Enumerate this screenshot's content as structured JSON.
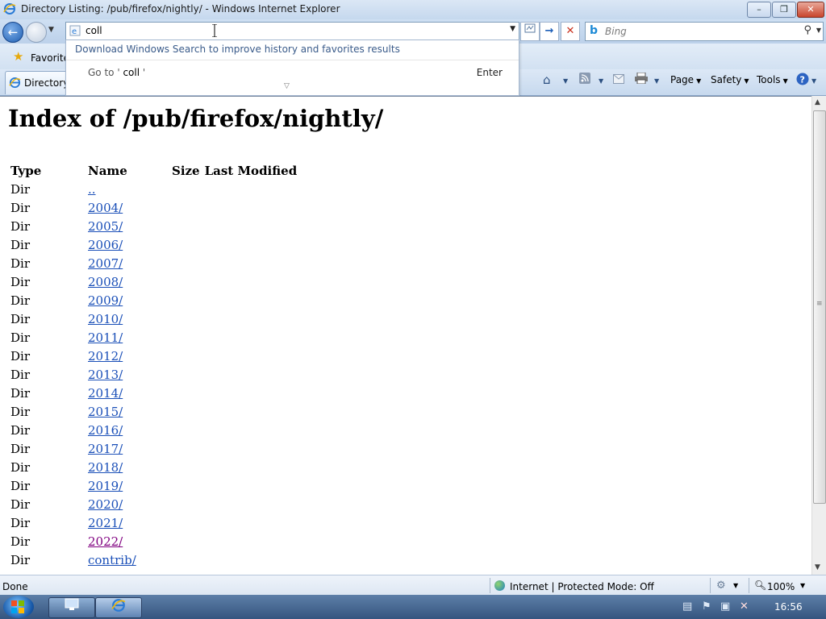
{
  "window": {
    "title": "Directory Listing: /pub/firefox/nightly/ - Windows Internet Explorer",
    "minimize": "–",
    "maximize": "❐",
    "close": "✕"
  },
  "nav": {
    "back_icon": "back-arrow-icon",
    "forward_icon": "forward-arrow-icon",
    "address_value": "coll",
    "search_placeholder": "Bing",
    "search_logo": "b",
    "compat_icon": "compatibility-view-icon",
    "go_icon": "→",
    "stop_icon": "✕"
  },
  "dropdown": {
    "download_text": "Download Windows Search to improve history and favorites results",
    "goto_prefix": "Go to '",
    "goto_value": "coll",
    "goto_suffix": "'",
    "enter": "Enter"
  },
  "favorites": {
    "label": "Favorite"
  },
  "tab": {
    "label": "Directory"
  },
  "commandbar": {
    "page": "Page",
    "safety": "Safety",
    "tools": "Tools"
  },
  "content": {
    "heading": "Index of /pub/firefox/nightly/",
    "columns": [
      "Type",
      "Name",
      "Size",
      "Last Modified"
    ],
    "rows": [
      {
        "type": "Dir",
        "name": "..",
        "visited": false
      },
      {
        "type": "Dir",
        "name": "2004/",
        "visited": false
      },
      {
        "type": "Dir",
        "name": "2005/",
        "visited": false
      },
      {
        "type": "Dir",
        "name": "2006/",
        "visited": false
      },
      {
        "type": "Dir",
        "name": "2007/",
        "visited": false
      },
      {
        "type": "Dir",
        "name": "2008/",
        "visited": false
      },
      {
        "type": "Dir",
        "name": "2009/",
        "visited": false
      },
      {
        "type": "Dir",
        "name": "2010/",
        "visited": false
      },
      {
        "type": "Dir",
        "name": "2011/",
        "visited": false
      },
      {
        "type": "Dir",
        "name": "2012/",
        "visited": false
      },
      {
        "type": "Dir",
        "name": "2013/",
        "visited": false
      },
      {
        "type": "Dir",
        "name": "2014/",
        "visited": false
      },
      {
        "type": "Dir",
        "name": "2015/",
        "visited": false
      },
      {
        "type": "Dir",
        "name": "2016/",
        "visited": false
      },
      {
        "type": "Dir",
        "name": "2017/",
        "visited": false
      },
      {
        "type": "Dir",
        "name": "2018/",
        "visited": false
      },
      {
        "type": "Dir",
        "name": "2019/",
        "visited": false
      },
      {
        "type": "Dir",
        "name": "2020/",
        "visited": false
      },
      {
        "type": "Dir",
        "name": "2021/",
        "visited": false
      },
      {
        "type": "Dir",
        "name": "2022/",
        "visited": true
      },
      {
        "type": "Dir",
        "name": "contrib/",
        "visited": false
      }
    ]
  },
  "status": {
    "left": "Done",
    "zone": "Internet | Protected Mode: Off",
    "zoom": "100%"
  },
  "taskbar": {
    "clock": "16:56"
  },
  "colors": {
    "link": "#1a4fb8",
    "visited_link": "#800080",
    "accent": "#3c76c4"
  }
}
